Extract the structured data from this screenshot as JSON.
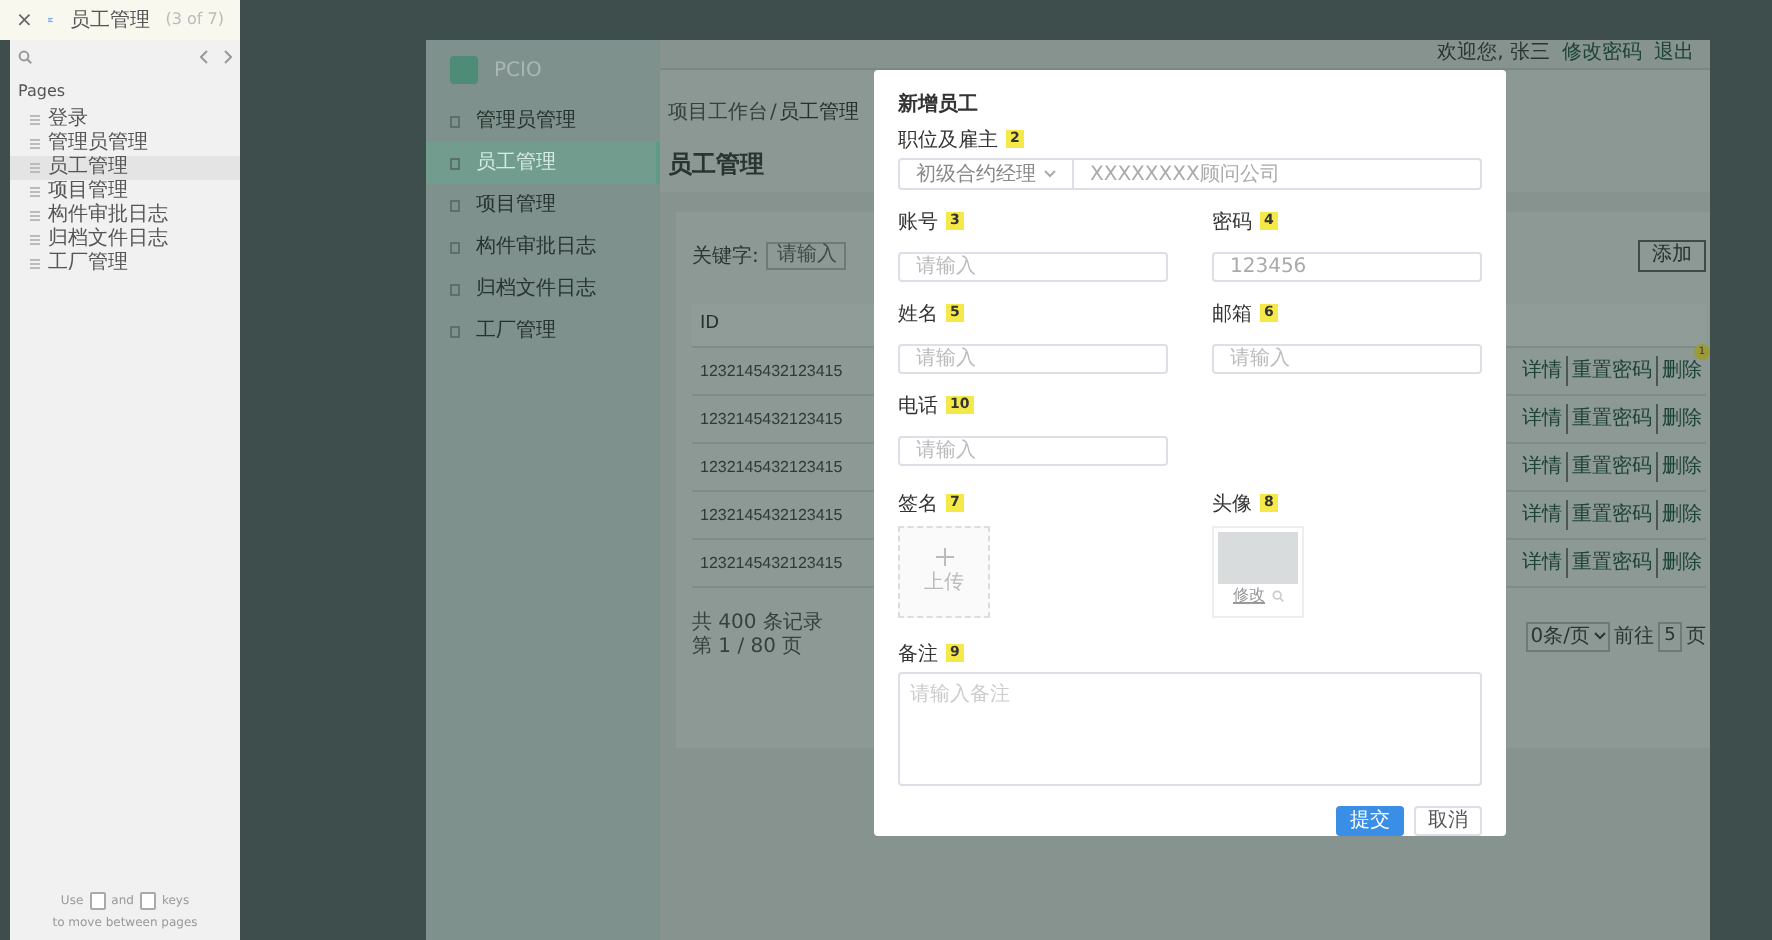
{
  "viewer": {
    "close": "×",
    "page_title": "员工管理",
    "page_count": "(3 of 7)",
    "pages_heading": "Pages",
    "pages": [
      {
        "label": "登录",
        "selected": false
      },
      {
        "label": "管理员管理",
        "selected": false
      },
      {
        "label": "员工管理",
        "selected": true
      },
      {
        "label": "项目管理",
        "selected": false
      },
      {
        "label": "构件审批日志",
        "selected": false
      },
      {
        "label": "归档文件日志",
        "selected": false
      },
      {
        "label": "工厂管理",
        "selected": false
      }
    ],
    "hint_words": [
      "Use",
      "and",
      "keys"
    ],
    "hint_line2": "to move between pages"
  },
  "app": {
    "logo": "PCIO",
    "sidebar": [
      {
        "label": "管理员管理",
        "selected": false
      },
      {
        "label": "员工管理",
        "selected": true
      },
      {
        "label": "项目管理",
        "selected": false
      },
      {
        "label": "构件审批日志",
        "selected": false
      },
      {
        "label": "归档文件日志",
        "selected": false
      },
      {
        "label": "工厂管理",
        "selected": false
      }
    ],
    "header": {
      "welcome": "欢迎您, 张三",
      "links": [
        "修改密码",
        "退出"
      ]
    },
    "breadcrumb": {
      "parent": "项目工作台",
      "sep": "/",
      "current": "员工管理"
    },
    "title": "员工管理",
    "filter": {
      "label": "关键字:",
      "placeholder": "请输入"
    },
    "add_button": "添加",
    "table": {
      "columns": [
        "ID"
      ],
      "note": "1",
      "rows": [
        {
          "id": "1232145432123415",
          "actions": [
            "详情",
            "重置密码",
            "删除"
          ]
        },
        {
          "id": "1232145432123415",
          "actions": [
            "详情",
            "重置密码",
            "删除"
          ]
        },
        {
          "id": "1232145432123415",
          "actions": [
            "详情",
            "重置密码",
            "删除"
          ]
        },
        {
          "id": "1232145432123415",
          "actions": [
            "详情",
            "重置密码",
            "删除"
          ]
        },
        {
          "id": "1232145432123415",
          "actions": [
            "详情",
            "重置密码",
            "删除"
          ]
        }
      ]
    },
    "pagination": {
      "summary": [
        "共 400 条记录",
        "第 1 / 80 页"
      ],
      "page_size": "0条/页",
      "goto": "前往",
      "page": "5",
      "unit": "页"
    }
  },
  "modal": {
    "title": "新增员工",
    "job": {
      "label": "职位及雇主",
      "note": "2",
      "select": "初级合约经理",
      "value": "XXXXXXXX顾问公司"
    },
    "fields": [
      {
        "label": "账号",
        "note": "3",
        "placeholder": "请输入"
      },
      {
        "label": "密码",
        "note": "4",
        "value": "123456"
      },
      {
        "label": "姓名",
        "note": "5",
        "placeholder": "请输入"
      },
      {
        "label": "邮箱",
        "note": "6",
        "placeholder": "请输入"
      },
      {
        "label": "电话",
        "note": "10",
        "placeholder": "请输入"
      }
    ],
    "signature": {
      "label": "签名",
      "note": "7",
      "upload": "上传"
    },
    "avatar": {
      "label": "头像",
      "note": "8",
      "change": "修改"
    },
    "remark": {
      "label": "备注",
      "note": "9",
      "placeholder": "请输入备注"
    },
    "buttons": [
      {
        "label": "提交",
        "kind": "primary"
      },
      {
        "label": "取消",
        "kind": "default"
      }
    ]
  }
}
